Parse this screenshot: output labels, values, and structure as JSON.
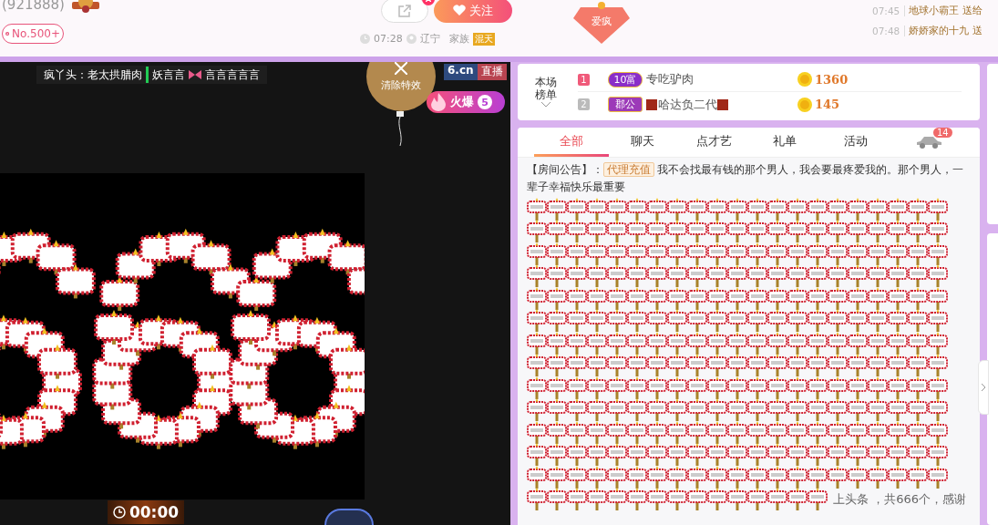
{
  "header": {
    "room_id": "(921888)",
    "rank_badge": "No.500+",
    "follow_button": "关注",
    "time": "07:28",
    "location": "辽宁",
    "family_label": "家族",
    "family_tag": "混天",
    "heart_badge": "爱疯"
  },
  "gift_feed": [
    {
      "time": "07:45",
      "text": "地球小霸王 送给"
    },
    {
      "time": "07:48",
      "text": "娇娇家的十九 送"
    }
  ],
  "video": {
    "danmaku_first": "疯丫头：老太拱腊肉",
    "danmaku_second_before": "妖言言",
    "danmaku_second_after": "言言言言言",
    "clear_effects_button": "清除特效",
    "logo_text": "6.cn",
    "logo_tag": "直播",
    "heat_label": "火爆",
    "heat_count": "5",
    "timer": "00:00"
  },
  "leaderboard": {
    "title_lines": [
      "本场",
      "榜单"
    ],
    "rows": [
      {
        "rank": "1",
        "badge": {
          "text": "10富",
          "kind": "wealth"
        },
        "name": "专吃驴肉",
        "decorated": false,
        "score": "1360"
      },
      {
        "rank": "2",
        "badge": {
          "text": "郡公",
          "kind": "noble"
        },
        "name": "哈达负二代",
        "decorated": true,
        "score": "145"
      }
    ]
  },
  "chat": {
    "tabs": [
      {
        "label": "全部",
        "selected": true
      },
      {
        "label": "聊天",
        "selected": false
      },
      {
        "label": "点才艺",
        "selected": false
      },
      {
        "label": "礼单",
        "selected": false
      },
      {
        "label": "活动",
        "selected": false
      }
    ],
    "car_badge": "14",
    "notice_label": "【房间公告】：",
    "notice_tag": "代理充值",
    "notice_text": "我不会找最有钱的那个男人，我会要最疼爱我的。那个男人，一辈子幸福快乐最重要",
    "gift_message": "上头条 ，共666个，感谢"
  }
}
